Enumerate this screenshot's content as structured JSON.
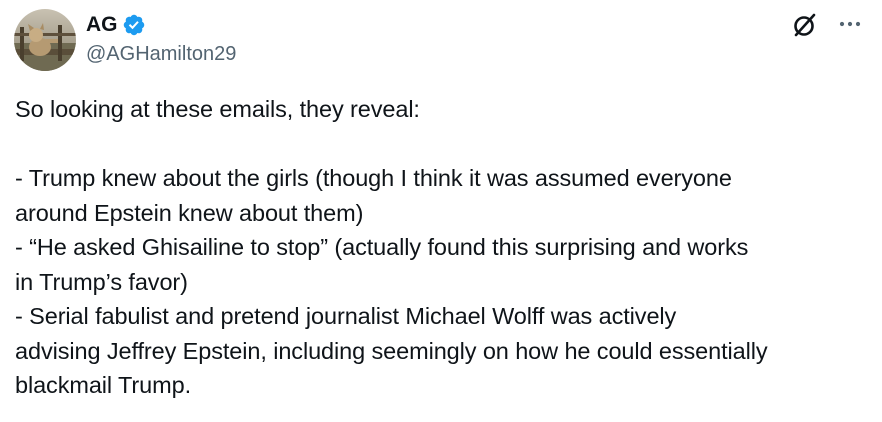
{
  "author": {
    "display_name": "AG",
    "handle": "@AGHamilton29",
    "verified": true,
    "verified_color": "#1d9bf0",
    "avatar_icon": "avatar-photo"
  },
  "actions": {
    "grok_icon": "grok-icon",
    "more_icon": "more-icon"
  },
  "tweet": {
    "lines": [
      "So looking at these emails, they reveal:",
      "",
      "- Trump knew about the girls (though I think it was assumed everyone",
      "around Epstein knew about them)",
      "- “He asked Ghisailine to stop” (actually found this surprising and works",
      "in Trump’s favor)",
      "- Serial fabulist and pretend journalist Michael Wolff was actively",
      "advising Jeffrey Epstein, including seemingly on how he could essentially",
      "blackmail Trump."
    ]
  }
}
